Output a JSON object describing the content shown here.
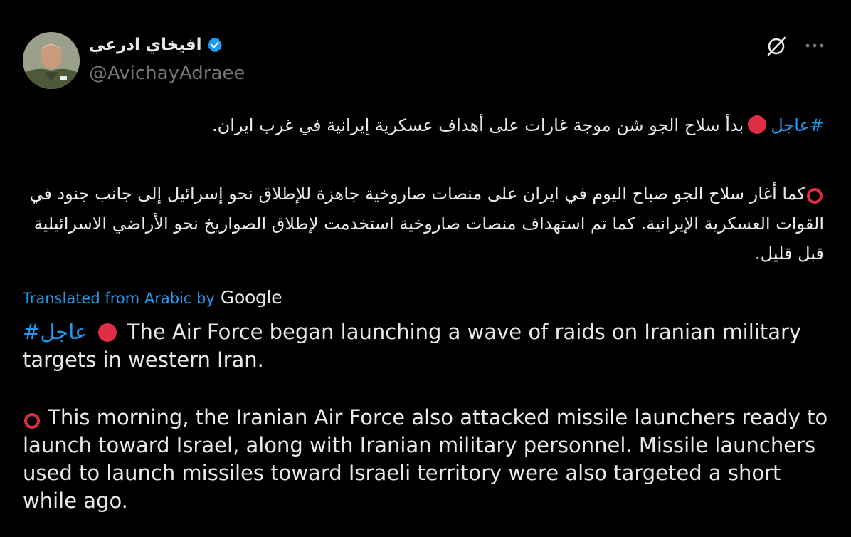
{
  "tweet": {
    "display_name": "افيخاي ادرعي",
    "handle": "@AvichayAdraee",
    "arabic": {
      "p1_hashtag": "#عاجل",
      "p1_text": "بدأ سلاح الجو شن موجة غارات على أهداف عسكرية إيرانية في غرب ايران.",
      "p2_text": "كما أغار سلاح الجو صباح اليوم في ايران على منصات صاروخية جاهزة للإطلاق نحو إسرائيل إلى جانب جنود في القوات العسكرية الإيرانية. كما تم استهداف منصات صاروخية استخدمت لإطلاق الصواريخ نحو الأراضي الاسرائيلية قبل قليل."
    },
    "translation": {
      "label": "Translated from Arabic by",
      "provider": "Google",
      "p1_hashtag": "#عاجل",
      "p1_text": "The Air Force began launching a wave of raids on Iranian military targets in western Iran.",
      "p2_text": "This morning, the Iranian Air Force also attacked missile launchers ready to launch toward Israel, along with Iranian military personnel. Missile launchers used to launch missiles toward Israeli territory were also targeted a short while ago."
    }
  },
  "icons": {
    "verified": "verified-badge-icon",
    "grok": "grok-icon",
    "more": "more-icon",
    "red_circle": "red-circle-emoji",
    "hollow_red_circle": "hollow-red-circle-emoji"
  },
  "colors": {
    "background": "#000000",
    "text": "#e7e9ea",
    "secondary": "#71767b",
    "link": "#1d9bf0",
    "verified": "#1d9bf0",
    "red_emoji": "#dd2e44"
  }
}
